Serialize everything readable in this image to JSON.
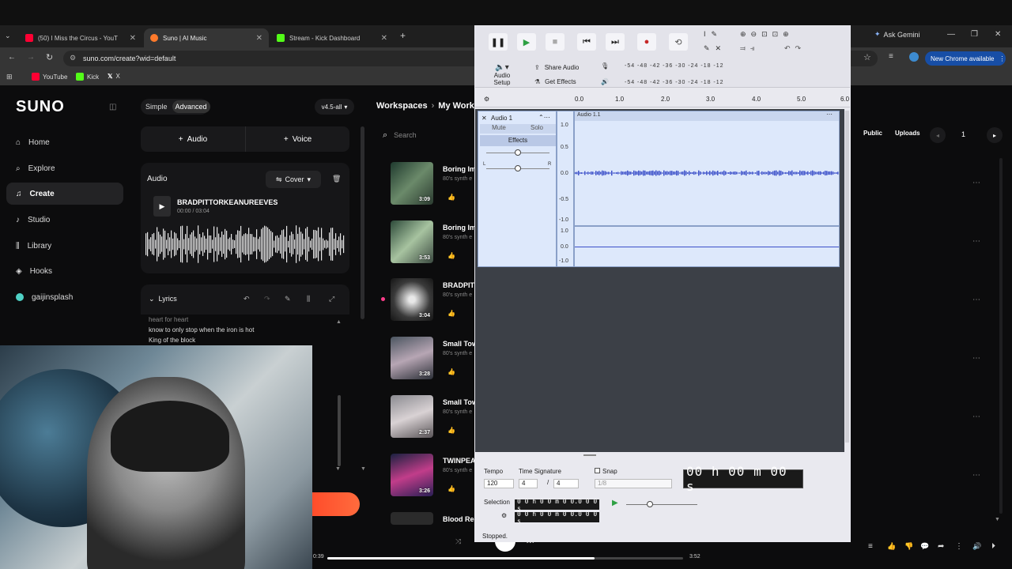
{
  "browser": {
    "tabs": [
      {
        "title": "(50) I Miss the Circus - YouT",
        "color": "#ff0033"
      },
      {
        "title": "Suno | AI Music",
        "color": "#ff7a2b"
      },
      {
        "title": "Stream - Kick Dashboard",
        "color": "#53fc18"
      }
    ],
    "url": "suno.com/create?wid=default",
    "bookmarks": [
      "YouTube",
      "Kick",
      "X"
    ],
    "ask_gemini": "Ask Gemini",
    "chrome_update": "New Chrome available"
  },
  "suno": {
    "logo": "SUNO",
    "modes": {
      "simple": "Simple",
      "advanced": "Advanced"
    },
    "version": "v4.5-all",
    "nav": [
      "Home",
      "Explore",
      "Create",
      "Studio",
      "Library",
      "Hooks",
      "gaijinsplash"
    ],
    "add_audio": "Audio",
    "add_voice": "Voice",
    "audio_label": "Audio",
    "cover_label": "Cover",
    "track_name": "BRADPITTORKEANUREEVES",
    "track_time": "00:00 / 03:04",
    "lyrics_label": "Lyrics",
    "lyrics_lines": [
      "heart for heart",
      "know to only stop when the iron is hot",
      "King of the block"
    ],
    "breadcrumb": [
      "Workspaces",
      "My Worksp"
    ],
    "search_placeholder": "Search",
    "filters": [
      "Public",
      "Uploads"
    ],
    "page_number": "1",
    "songs": [
      {
        "title": "Boring Im",
        "sub": "80's synth e",
        "duration": "3:09"
      },
      {
        "title": "Boring Im",
        "sub": "80's synth e",
        "duration": "3:53"
      },
      {
        "title": "BRADPIT",
        "sub": "80's synth e",
        "duration": "3:04"
      },
      {
        "title": "Small Tow",
        "sub": "80's synth e",
        "duration": "3:28"
      },
      {
        "title": "Small Tow",
        "sub": "80's synth e",
        "duration": "2:37"
      },
      {
        "title": "TWINPEA",
        "sub": "80's synth e",
        "duration": "3:26"
      },
      {
        "title": "Blood Red",
        "sub": "",
        "duration": ""
      }
    ],
    "player": {
      "elapsed": "0:39",
      "total": "3:52",
      "progress": 0.75
    }
  },
  "audacity": {
    "share_audio": "Share Audio",
    "get_effects": "Get Effects",
    "audio_setup": "Audio Setup",
    "meter_scale": "-54 -48 -42 -36 -30 -24 -18 -12",
    "ruler": [
      "0.0",
      "1.0",
      "2.0",
      "3.0",
      "4.0",
      "5.0",
      "6.0"
    ],
    "track_name": "Audio 1",
    "clip_name": "Audio 1.1",
    "mute": "Mute",
    "solo": "Solo",
    "effects": "Effects",
    "pan_left": "L",
    "pan_right": "R",
    "yaxis": [
      "1.0",
      "0.5",
      "0.0",
      "-0.5",
      "-1.0"
    ],
    "yaxis2": [
      "1.0",
      "0.0",
      "-1.0"
    ],
    "tempo_label": "Tempo",
    "tempo": "120",
    "time_sig_label": "Time Signature",
    "time_sig_num": "4",
    "time_sig_den": "4",
    "snap_label": "Snap",
    "snap_value": "1/8",
    "big_time": "00 h 00 m 00 s",
    "selection_label": "Selection",
    "sel_start": "0 0 h 0 0 m 0 0.0 0 0 s",
    "sel_end": "0 0 h 0 0 m 0 0.0 0 0 s",
    "status": "Stopped."
  }
}
